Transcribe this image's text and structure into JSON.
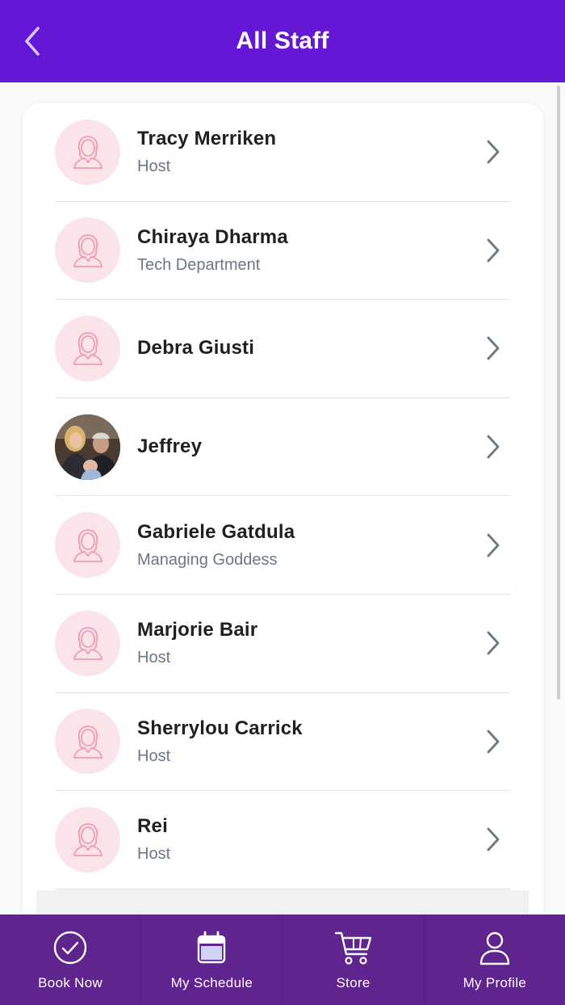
{
  "header": {
    "title": "All Staff",
    "back_icon": "chevron-left-icon"
  },
  "colors": {
    "header_bg": "#6517d6",
    "nav_bg": "#60248f",
    "avatar_bg": "#fbe3ea",
    "avatar_icon": "#ef9bb4"
  },
  "staff": [
    {
      "name": "Tracy Merriken",
      "role": "Host",
      "avatar": "person-placeholder-icon"
    },
    {
      "name": "Chiraya Dharma",
      "role": "Tech Department",
      "avatar": "person-placeholder-icon"
    },
    {
      "name": "Debra Giusti",
      "role": "",
      "avatar": "person-placeholder-icon"
    },
    {
      "name": "Jeffrey",
      "role": "",
      "avatar": "photo"
    },
    {
      "name": "Gabriele Gatdula",
      "role": "Managing Goddess",
      "avatar": "person-placeholder-icon"
    },
    {
      "name": "Marjorie Bair",
      "role": "Host",
      "avatar": "person-placeholder-icon"
    },
    {
      "name": "Sherrylou Carrick",
      "role": "Host",
      "avatar": "person-placeholder-icon"
    },
    {
      "name": "Rei",
      "role": "Host",
      "avatar": "person-placeholder-icon"
    }
  ],
  "nav": [
    {
      "label": "Book Now",
      "icon": "check-circle-icon"
    },
    {
      "label": "My Schedule",
      "icon": "calendar-icon"
    },
    {
      "label": "Store",
      "icon": "cart-icon"
    },
    {
      "label": "My Profile",
      "icon": "user-icon"
    }
  ]
}
